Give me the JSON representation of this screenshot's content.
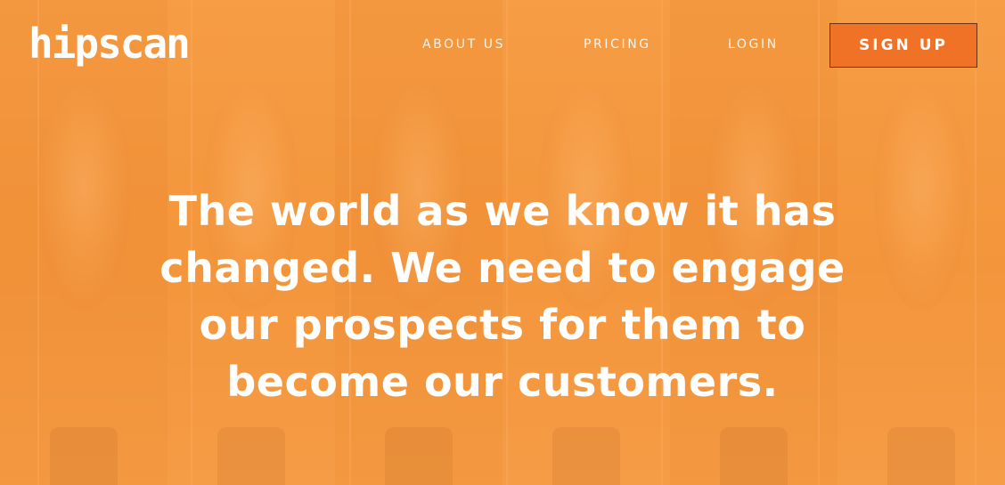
{
  "brand": {
    "logo_text": "hipscan",
    "accent_color": "#ef7227",
    "overlay_color": "#f4973a"
  },
  "nav": {
    "items": [
      {
        "label": "ABOUT US"
      },
      {
        "label": "PRICING"
      },
      {
        "label": "LOGIN"
      }
    ],
    "signup_label": "SIGN UP"
  },
  "hero": {
    "headline_lines": [
      "The world as we know it has",
      "changed. We need to engage",
      "our prospects for them to",
      "become our customers."
    ]
  }
}
